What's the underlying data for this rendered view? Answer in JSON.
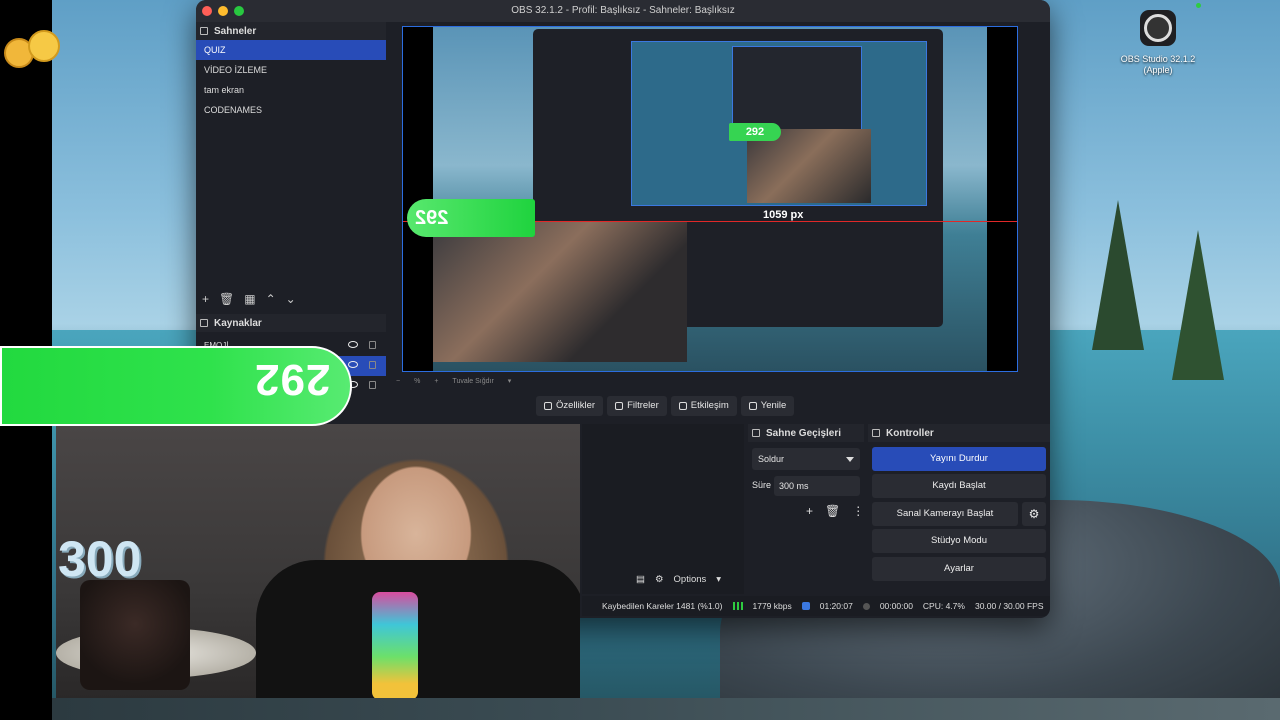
{
  "window": {
    "title": "OBS 32.1.2 - Profil: Başlıksız - Sahneler: Başlıksız"
  },
  "desktop": {
    "app_icon_label": "OBS Studio 32.1.2 (Apple)"
  },
  "scenes": {
    "header": "Sahneler",
    "items": [
      "QUIZ",
      "VİDEO İZLEME",
      "tam ekran",
      "CODENAMES"
    ],
    "selected": "QUIZ"
  },
  "sources": {
    "header": "Kaynaklar",
    "items": [
      "EMOJİ"
    ]
  },
  "preview": {
    "measure_label": "1059 px",
    "counter_small": "292",
    "counter_big": "292",
    "zoom_label": "%",
    "fit_label": "Tuvale Sığdır"
  },
  "tabs": [
    {
      "label": "Özellikler",
      "icon": "gear-icon"
    },
    {
      "label": "Filtreler",
      "icon": "filter-icon"
    },
    {
      "label": "Etkileşim",
      "icon": "hand-icon"
    },
    {
      "label": "Yenile",
      "icon": "refresh-icon"
    }
  ],
  "mixer": {
    "options_label": "Options"
  },
  "transitions": {
    "header": "Sahne Geçişleri",
    "selected": "Soldur",
    "duration_label": "Süre",
    "duration_value": "300 ms"
  },
  "controls": {
    "header": "Kontroller",
    "buttons": [
      "Yayını Durdur",
      "Kaydı Başlat",
      "Sanal Kamerayı Başlat",
      "Stüdyo Modu",
      "Ayarlar"
    ]
  },
  "status": {
    "dropped": "Kaybedilen Kareler 1481 (%1.0)",
    "bitrate": "1779 kbps",
    "stream_time": "01:20:07",
    "rec_time": "00:00:00",
    "cpu": "CPU: 4.7%",
    "fps": "30.00 / 30.00 FPS"
  },
  "overlay": {
    "counter": "292",
    "cake_text": "300"
  },
  "colors": {
    "accent": "#284cb8",
    "counter_green": "#2fe24c"
  }
}
